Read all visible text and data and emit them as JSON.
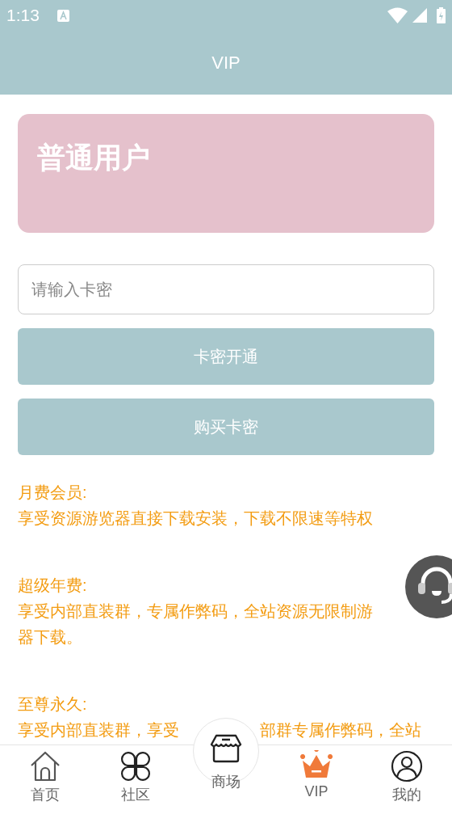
{
  "status_bar": {
    "time": "1:13"
  },
  "header": {
    "title": "VIP"
  },
  "member_card": {
    "title": "普通用户"
  },
  "card_input": {
    "placeholder": "请输入卡密"
  },
  "buttons": [
    "卡密开通",
    "购买卡密"
  ],
  "sections": [
    {
      "title": "月费会员:",
      "lines": [
        [
          "享受资源游览器直接下载安装，下载不限速等特权"
        ]
      ]
    },
    {
      "title": "超级年费:",
      "lines": [
        [
          "享受内部直装群，专属作弊码，全站资源无限制游"
        ],
        [
          "器下载。"
        ]
      ]
    },
    {
      "title": "至尊永久:",
      "lines": [
        [
          "享受内部直装群，享受",
          "部群专属作弊码，全站"
        ]
      ]
    }
  ],
  "nav": [
    {
      "kind": "home",
      "label": "首页",
      "selected": false
    },
    {
      "kind": "community",
      "label": "社区",
      "selected": false
    },
    {
      "kind": "store",
      "label": "商场",
      "selected": false
    },
    {
      "kind": "vip",
      "label": "VIP",
      "selected": true
    },
    {
      "kind": "profile",
      "label": "我的",
      "selected": false
    }
  ]
}
